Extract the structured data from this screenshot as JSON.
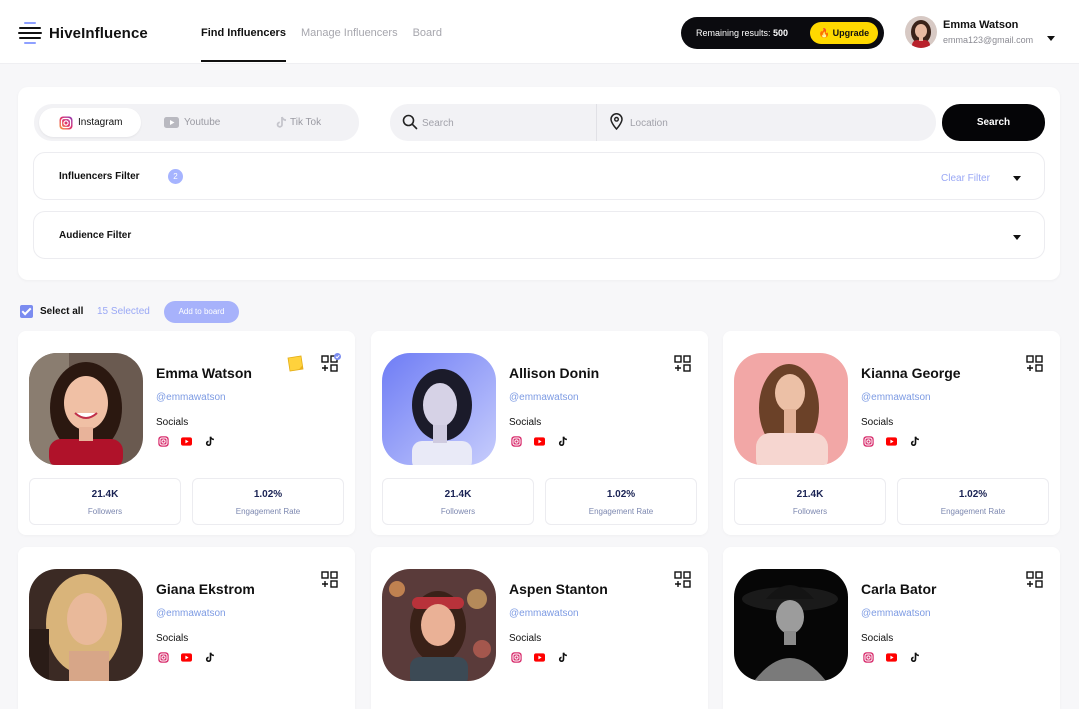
{
  "app": {
    "name": "HiveInfluence"
  },
  "nav": {
    "items": [
      {
        "label": "Find Influencers"
      },
      {
        "label": "Manage Influencers"
      },
      {
        "label": "Board"
      }
    ]
  },
  "remaining": {
    "label": "Remaining results:",
    "count": "500",
    "upgrade_label": "Upgrade"
  },
  "user": {
    "name": "Emma Watson",
    "email": "emma123@gmail.com"
  },
  "platforms": [
    {
      "label": "Instagram",
      "icon": "instagram-icon"
    },
    {
      "label": "Youtube",
      "icon": "youtube-icon"
    },
    {
      "label": "Tik Tok",
      "icon": "tiktok-icon"
    }
  ],
  "search": {
    "placeholder": "Search",
    "location_placeholder": "Location",
    "button_label": "Search"
  },
  "filters": {
    "influencers_label": "Influencers Filter",
    "influencers_count": "2",
    "clear_label": "Clear Filter",
    "audience_label": "Audience Filter"
  },
  "selection": {
    "select_all_label": "Select all",
    "selected_label": "15 Selected",
    "add_to_board_label": "Add to board"
  },
  "colors": {
    "accent": "#9aa8f5",
    "primary_dark": "#050507",
    "upgrade_yellow": "#ffd900",
    "handle_blue": "#7d9be3"
  },
  "cards": [
    {
      "name": "Emma Watson",
      "handle": "@emmawatson",
      "socials_label": "Socials",
      "followers": "21.4K",
      "followers_label": "Followers",
      "engagement": "1.02%",
      "engagement_label": "Engagement Rate"
    },
    {
      "name": "Allison Donin",
      "handle": "@emmawatson",
      "socials_label": "Socials",
      "followers": "21.4K",
      "followers_label": "Followers",
      "engagement": "1.02%",
      "engagement_label": "Engagement Rate"
    },
    {
      "name": "Kianna George",
      "handle": "@emmawatson",
      "socials_label": "Socials",
      "followers": "21.4K",
      "followers_label": "Followers",
      "engagement": "1.02%",
      "engagement_label": "Engagement Rate"
    },
    {
      "name": "Giana Ekstrom",
      "handle": "@emmawatson",
      "socials_label": "Socials"
    },
    {
      "name": "Aspen Stanton",
      "handle": "@emmawatson",
      "socials_label": "Socials"
    },
    {
      "name": "Carla Bator",
      "handle": "@emmawatson",
      "socials_label": "Socials"
    }
  ]
}
